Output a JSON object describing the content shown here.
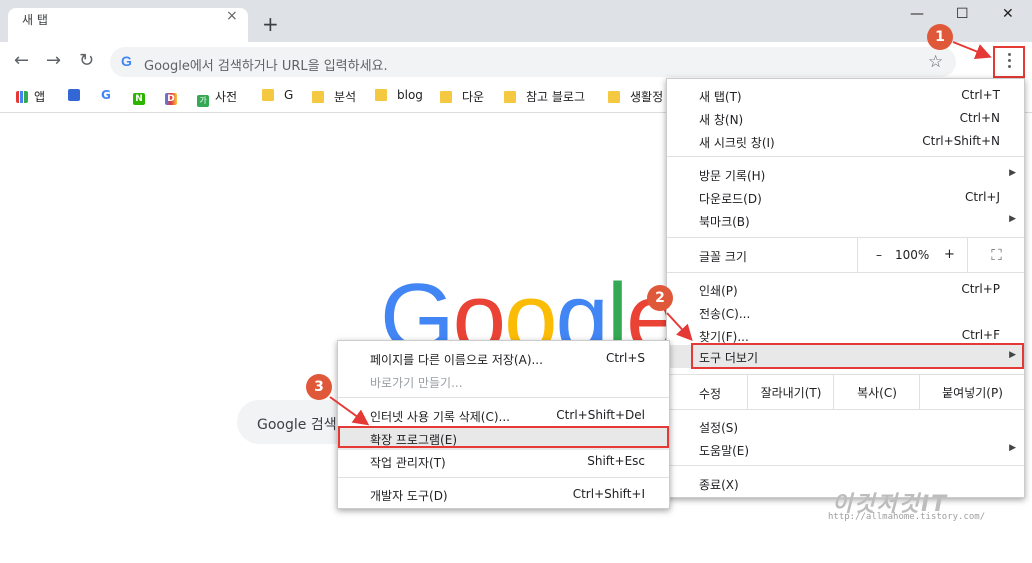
{
  "tab": {
    "title": "새 탭",
    "close": "×",
    "new": "+"
  },
  "window": {
    "minimize": "—",
    "maximize": "☐",
    "close": "✕"
  },
  "toolbar": {
    "back": "←",
    "forward": "→",
    "reload": "↻",
    "omni_g": "G",
    "omni_placeholder": "Google에서 검색하거나 URL을 입력하세요.",
    "star": "☆"
  },
  "bookmarks": [
    {
      "label": "앱"
    },
    {
      "label": ""
    },
    {
      "label": ""
    },
    {
      "label": ""
    },
    {
      "label": ""
    },
    {
      "label": "사전"
    },
    {
      "label": "G"
    },
    {
      "label": "분석"
    },
    {
      "label": "blog"
    },
    {
      "label": "다운"
    },
    {
      "label": "참고 블로그"
    },
    {
      "label": "생활정"
    }
  ],
  "bookmark_icons": {
    "naver": "N",
    "daum": "D",
    "dict": "가",
    "google": "G"
  },
  "google_logo": [
    "G",
    "o",
    "o",
    "g",
    "l",
    "e"
  ],
  "search_box": {
    "text": "Google 검색"
  },
  "menu": {
    "new_tab": {
      "label": "새 탭(T)",
      "shortcut": "Ctrl+T"
    },
    "new_window": {
      "label": "새 창(N)",
      "shortcut": "Ctrl+N"
    },
    "incognito": {
      "label": "새 시크릿 창(I)",
      "shortcut": "Ctrl+Shift+N"
    },
    "history": {
      "label": "방문 기록(H)"
    },
    "downloads": {
      "label": "다운로드(D)",
      "shortcut": "Ctrl+J"
    },
    "bookmarks": {
      "label": "북마크(B)"
    },
    "zoom": {
      "label": "글꼴 크기",
      "minus": "–",
      "value": "100%",
      "plus": "+",
      "fullscreen": "⛶"
    },
    "print": {
      "label": "인쇄(P)",
      "shortcut": "Ctrl+P"
    },
    "cast": {
      "label": "전송(C)..."
    },
    "find": {
      "label": "찾기(F)...",
      "shortcut": "Ctrl+F"
    },
    "more_tools": {
      "label": "도구 더보기"
    },
    "edit": {
      "label": "수정",
      "cut": "잘라내기(T)",
      "copy": "복사(C)",
      "paste": "붙여넣기(P)"
    },
    "settings": {
      "label": "설정(S)"
    },
    "help": {
      "label": "도움말(E)"
    },
    "exit": {
      "label": "종료(X)"
    }
  },
  "submenu": {
    "save_as": {
      "label": "페이지를 다른 이름으로 저장(A)...",
      "shortcut": "Ctrl+S"
    },
    "shortcut": {
      "label": "바로가기 만들기..."
    },
    "clear_data": {
      "label": "인터넷 사용 기록 삭제(C)...",
      "shortcut": "Ctrl+Shift+Del"
    },
    "extensions": {
      "label": "확장 프로그램(E)"
    },
    "task_manager": {
      "label": "작업 관리자(T)",
      "shortcut": "Shift+Esc"
    },
    "dev_tools": {
      "label": "개발자 도구(D)",
      "shortcut": "Ctrl+Shift+I"
    }
  },
  "annotations": {
    "step1": "1",
    "step2": "2",
    "step3": "3"
  },
  "watermark": {
    "text": "이것저것IT",
    "url": "http://allmahome.tistory.com/"
  },
  "colors": {
    "accent_red": "#e53935",
    "badge": "#e0583a"
  }
}
